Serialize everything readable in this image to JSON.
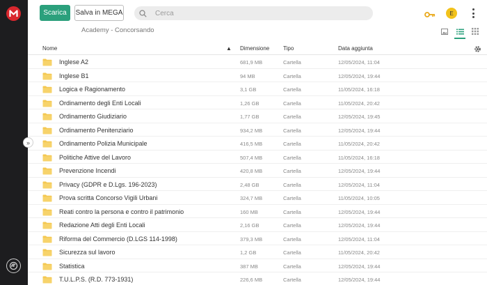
{
  "topbar": {
    "download_label": "Scarica",
    "save_label": "Salva in MEGA",
    "search_placeholder": "Cerca",
    "avatar_initial": "E",
    "accent_color": "#2ba07c",
    "brand_color": "#d9272e"
  },
  "breadcrumb": "Academy - Concorsando",
  "table": {
    "headers": {
      "name": "Nome",
      "size": "Dimensione",
      "type": "Tipo",
      "date": "Data aggiunta"
    },
    "rows": [
      {
        "name": "Inglese A2",
        "size": "681,9 MB",
        "type": "Cartella",
        "date": "12/05/2024, 11:04"
      },
      {
        "name": "Inglese B1",
        "size": "94 MB",
        "type": "Cartella",
        "date": "12/05/2024, 19:44"
      },
      {
        "name": "Logica e Ragionamento",
        "size": "3,1 GB",
        "type": "Cartella",
        "date": "11/05/2024, 16:18"
      },
      {
        "name": "Ordinamento degli Enti Locali",
        "size": "1,26 GB",
        "type": "Cartella",
        "date": "11/05/2024, 20:42"
      },
      {
        "name": "Ordinamento Giudiziario",
        "size": "1,77 GB",
        "type": "Cartella",
        "date": "12/05/2024, 19:45"
      },
      {
        "name": "Ordinamento Penitenziario",
        "size": "934,2 MB",
        "type": "Cartella",
        "date": "12/05/2024, 19:44"
      },
      {
        "name": "Ordinamento Polizia Municipale",
        "size": "416,5 MB",
        "type": "Cartella",
        "date": "11/05/2024, 20:42"
      },
      {
        "name": "Politiche Attive del Lavoro",
        "size": "507,4 MB",
        "type": "Cartella",
        "date": "11/05/2024, 16:18"
      },
      {
        "name": "Prevenzione Incendi",
        "size": "420,8 MB",
        "type": "Cartella",
        "date": "12/05/2024, 19:44"
      },
      {
        "name": "Privacy (GDPR e D.Lgs. 196-2023)",
        "size": "2,48 GB",
        "type": "Cartella",
        "date": "12/05/2024, 11:04"
      },
      {
        "name": "Prova scritta Concorso Vigili Urbani",
        "size": "324,7 MB",
        "type": "Cartella",
        "date": "11/05/2024, 10:05"
      },
      {
        "name": "Reati contro la persona e contro il patrimonio",
        "size": "160 MB",
        "type": "Cartella",
        "date": "12/05/2024, 19:44"
      },
      {
        "name": "Redazione Atti degli Enti Locali",
        "size": "2,16 GB",
        "type": "Cartella",
        "date": "12/05/2024, 19:44"
      },
      {
        "name": "Riforma del Commercio (D.LGS 114-1998)",
        "size": "379,3 MB",
        "type": "Cartella",
        "date": "12/05/2024, 11:04"
      },
      {
        "name": "Sicurezza sul lavoro",
        "size": "1,2 GB",
        "type": "Cartella",
        "date": "11/05/2024, 20:42"
      },
      {
        "name": "Statistica",
        "size": "387 MB",
        "type": "Cartella",
        "date": "12/05/2024, 19:44"
      },
      {
        "name": "T.U.L.P.S. (R.D. 773-1931)",
        "size": "226,6 MB",
        "type": "Cartella",
        "date": "12/05/2024, 19:44"
      }
    ]
  },
  "icons": {
    "logo": "mega-logo-icon",
    "search": "search-icon",
    "key": "key-icon",
    "menu": "kebab-menu-icon",
    "folder": "folder-icon",
    "settings": "gear-icon"
  },
  "folder_color": "#f4c852"
}
